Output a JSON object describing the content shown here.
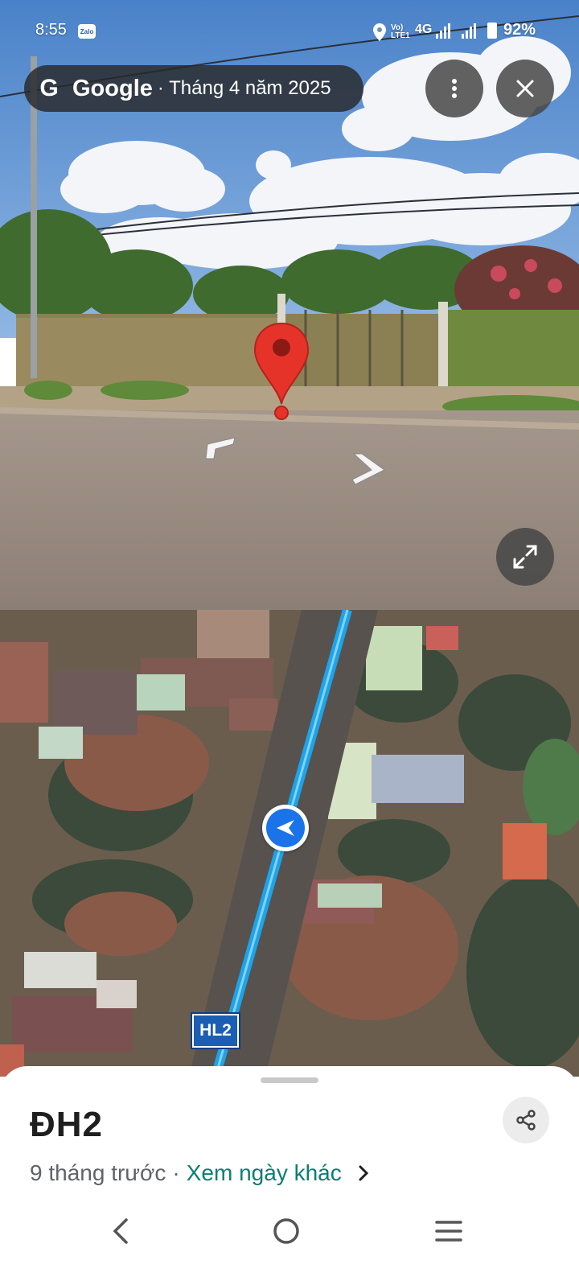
{
  "status_bar": {
    "time": "8:55",
    "notification_icon": "zalo-icon",
    "zalo_label": "Zalo",
    "network_label": "Vo) LTE1",
    "network_type": "4G",
    "battery": "92%"
  },
  "header": {
    "logo": "G",
    "brand": "Google",
    "date": "· Tháng 4 năm 2025",
    "more_icon": "more-vert-icon",
    "close_icon": "close-icon"
  },
  "street_view": {
    "prev_arrow_icon": "chevron-left-icon",
    "next_arrow_icon": "chevron-right-icon",
    "expand_icon": "expand-icon",
    "pin_icon": "location-pin-icon"
  },
  "map": {
    "road_label": "HL2",
    "accent": "#1fa3e8",
    "position_icon": "navigation-arrow-icon"
  },
  "sheet": {
    "title": "ĐH2",
    "age": "9 tháng trước",
    "separator": "·",
    "other_dates_link": "Xem ngày khác",
    "chevron_icon": "chevron-right-icon",
    "share_icon": "share-icon",
    "link_color": "#0b7e74"
  },
  "nav_bar": {
    "back_icon": "back-icon",
    "home_icon": "home-icon",
    "recents_icon": "recents-icon"
  }
}
